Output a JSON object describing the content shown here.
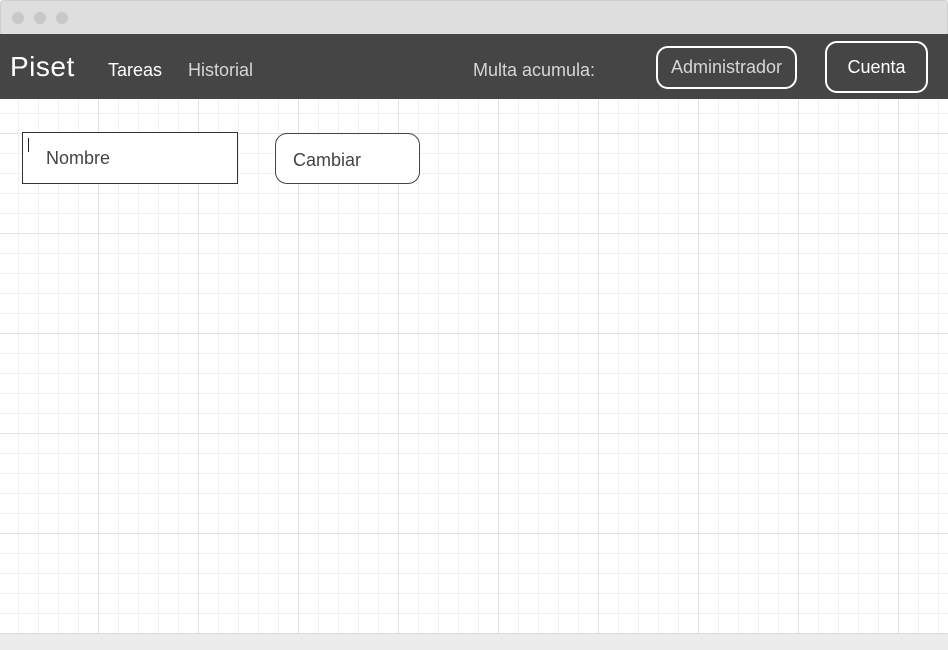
{
  "navbar": {
    "brand": "Piset",
    "links": {
      "tareas": "Tareas",
      "historial": "Historial"
    },
    "multa_label": "Multa acumula:",
    "admin_button": "Administrador",
    "account_button": "Cuenta"
  },
  "form": {
    "name_input": {
      "value": "",
      "placeholder": "Nombre"
    },
    "change_button": "Cambiar"
  },
  "colors": {
    "navbar_bg": "#454545",
    "titlebar_bg": "#dedede",
    "grid_line": "#e2e2e2"
  }
}
